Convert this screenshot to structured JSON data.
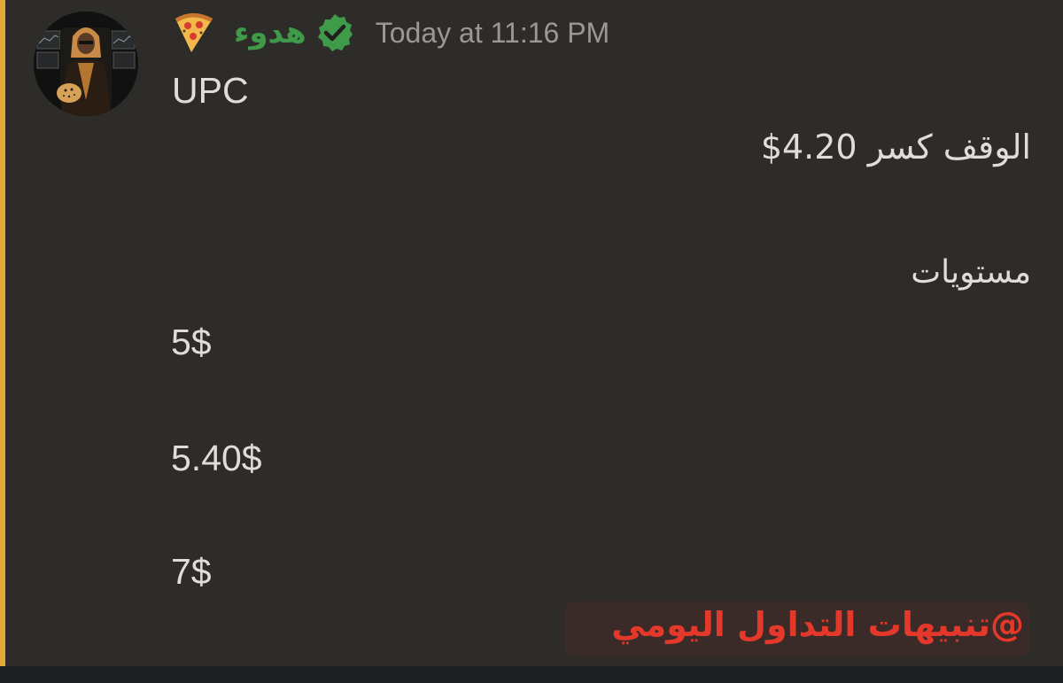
{
  "message": {
    "author": {
      "display_name": "هدوء",
      "name_color": "#3f9b4a",
      "avatar_icon": "avatar-man-with-cheetah",
      "emoji_icon": "pizza-icon",
      "verified_icon": "verified-check-icon"
    },
    "timestamp": "Today at 11:16 PM",
    "mention_color": "#e5a937",
    "lines": {
      "ticker": "UPC",
      "stop": "الوقف كسر 4.20$",
      "levels_label": "مستويات",
      "levels": [
        "5$",
        "5.40$",
        "7$"
      ]
    }
  },
  "watermark": {
    "text": "@تنبيهات التداول اليومي",
    "color": "#e4382a"
  }
}
